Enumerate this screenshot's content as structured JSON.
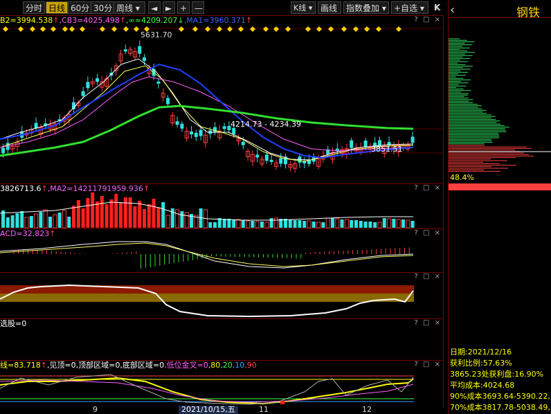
{
  "toolbar": {
    "periods": [
      "分时",
      "日线",
      "60分",
      "30分",
      "周线 ▾"
    ],
    "active_period": "日线",
    "nav": [
      "◄",
      "►",
      "+",
      "—"
    ],
    "k_type": "K线 ▾",
    "draw": "画线",
    "overlay": "指数叠加 ▾",
    "watchlist": "+自选 ▾",
    "collapse": "K"
  },
  "main_panel": {
    "legend": [
      {
        "text": "B2=3994.538",
        "color": "#ffff00"
      },
      {
        "text": "↑",
        "color": "#ff4040"
      },
      {
        "text": ",CB3=4025.498",
        "color": "#ff60ff"
      },
      {
        "text": "↑",
        "color": "#ff4040"
      },
      {
        "text": ",∞=4209.207",
        "color": "#40ff40"
      },
      {
        "text": "↓",
        "color": "#40ff40"
      },
      {
        "text": ",MA1=3960.371",
        "color": "#4060ff"
      },
      {
        "text": "↑",
        "color": "#ff4040"
      }
    ],
    "high_label": "5631.70",
    "range_label": "4214.73 - 4234.39",
    "last_label": "3851.51"
  },
  "vol_panel": {
    "legend": [
      {
        "text": "3826713.6",
        "color": "#ffffff"
      },
      {
        "text": "↑",
        "color": "#ff4040"
      },
      {
        "text": ",MA2=14211791959.936",
        "color": "#ff60ff"
      },
      {
        "text": "↑",
        "color": "#ff4040"
      }
    ]
  },
  "macd_panel": {
    "legend": [
      {
        "text": "ACD=32.823",
        "color": "#ff60ff"
      },
      {
        "text": "↑",
        "color": "#ff4040"
      }
    ]
  },
  "band_panel": {
    "legend": []
  },
  "empty_panel": {
    "legend": [
      {
        "text": "选股=0",
        "color": "#ffffff"
      }
    ]
  },
  "kdj_panel": {
    "legend": [
      {
        "text": "线=83.718",
        "color": "#ffff00"
      },
      {
        "text": "↑",
        "color": "#ff4040"
      },
      {
        "text": ",见顶=0",
        "color": "#ffffff"
      },
      {
        "text": ",顶部区域=0",
        "color": "#ffffff"
      },
      {
        "text": ",底部区域=0",
        "color": "#ffffff"
      },
      {
        "text": ",低位金叉=0",
        "color": "#ff60ff"
      },
      {
        "text": ",80",
        "color": "#ffff00"
      },
      {
        "text": ",20",
        "color": "#40ff40"
      },
      {
        "text": ",10",
        "color": "#40a0ff"
      },
      {
        "text": ",90",
        "color": "#ff4040"
      }
    ]
  },
  "panel_controls": "? □ ×",
  "date_axis": {
    "labels": [
      "9",
      "2021/10/15,五",
      "11",
      "12"
    ]
  },
  "right_pane": {
    "title": "钢铁",
    "back_icon": "‹",
    "percent": "48.4%",
    "date": "日期:2021/12/16",
    "profit_ratio": "获利比例:57.63%",
    "profit_at": "3865.23处获利盘:16.90%",
    "avg_cost": "平均成本:4024.68",
    "cost90": "90%成本3693.64-5390.22,",
    "cost70": "70%成本3817.78-5038.49,"
  }
}
